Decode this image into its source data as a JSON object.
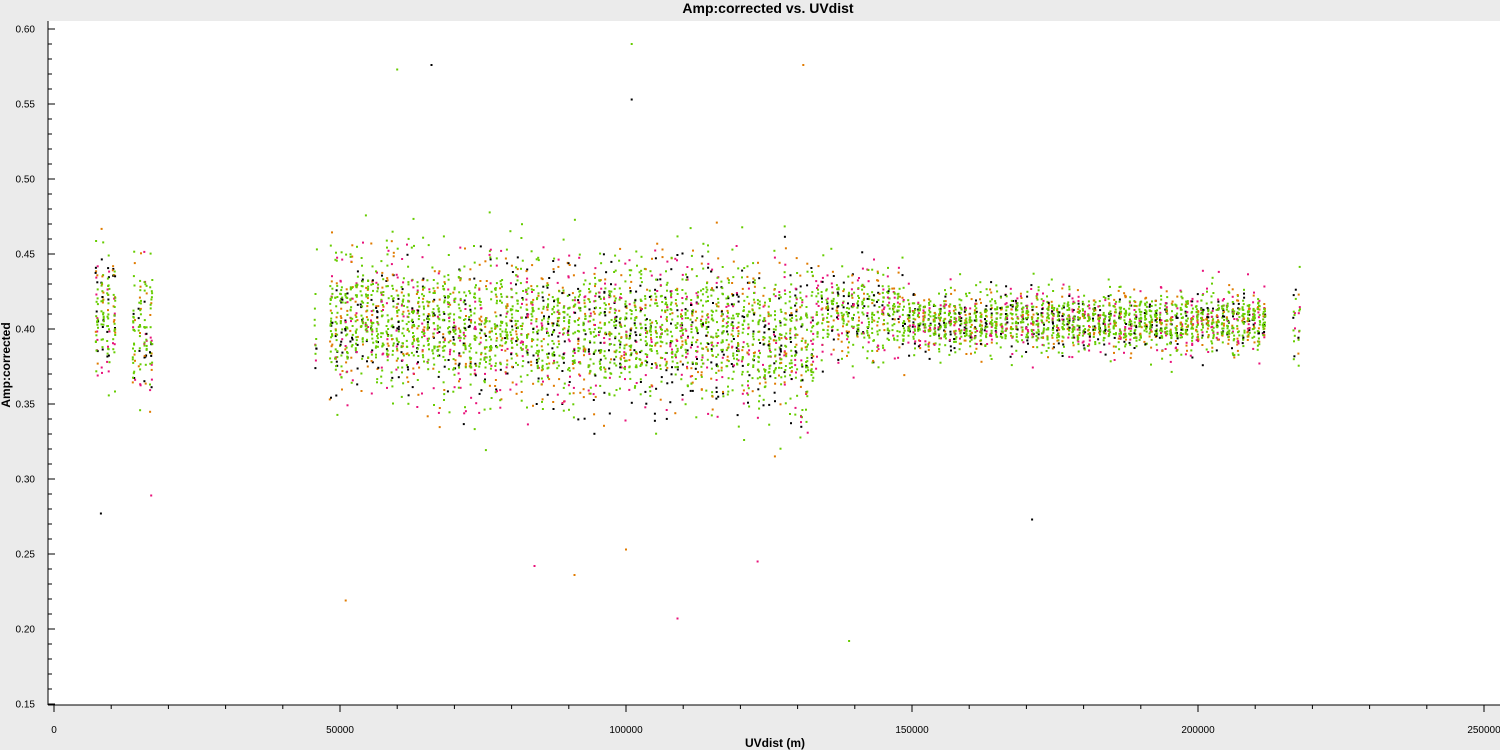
{
  "chart_data": {
    "type": "scatter",
    "title": "Amp:corrected vs. UVdist",
    "xlabel": "UVdist (m)",
    "ylabel": "Amp:corrected",
    "xlim": [
      0,
      250000
    ],
    "ylim": [
      0.15,
      0.6
    ],
    "x_ticks": [
      0,
      50000,
      100000,
      150000,
      200000,
      250000
    ],
    "x_tick_labels": [
      "0",
      "50000",
      "100000",
      "150000",
      "200000",
      "250000"
    ],
    "y_ticks": [
      0.15,
      0.2,
      0.25,
      0.3,
      0.35,
      0.4,
      0.45,
      0.5,
      0.55,
      0.6
    ],
    "y_tick_labels": [
      "0.15",
      "0.20",
      "0.25",
      "0.30",
      "0.35",
      "0.40",
      "0.45",
      "0.50",
      "0.55",
      "0.60"
    ],
    "grid": false,
    "legend": "none",
    "series_colors": [
      "#000000",
      "#e8127a",
      "#e07b00",
      "#66cc00"
    ],
    "clusters": [
      {
        "x_range": [
          7000,
          11000
        ],
        "median": 0.41,
        "spread": 0.055,
        "density": 1.0
      },
      {
        "x_range": [
          13500,
          17500
        ],
        "median": 0.4,
        "spread": 0.055,
        "density": 0.9
      },
      {
        "x_range": [
          45500,
          46000
        ],
        "median": 0.4,
        "spread": 0.06,
        "density": 0.4
      },
      {
        "x_range": [
          48000,
          65000
        ],
        "median": 0.405,
        "spread": 0.055,
        "density": 1.0
      },
      {
        "x_range": [
          65000,
          95000
        ],
        "median": 0.4,
        "spread": 0.06,
        "density": 1.0
      },
      {
        "x_range": [
          95000,
          120000
        ],
        "median": 0.4,
        "spread": 0.06,
        "density": 1.0
      },
      {
        "x_range": [
          120000,
          133000
        ],
        "median": 0.395,
        "spread": 0.065,
        "density": 1.0
      },
      {
        "x_range": [
          133000,
          149000
        ],
        "median": 0.41,
        "spread": 0.04,
        "density": 0.7
      },
      {
        "x_range": [
          149000,
          212000
        ],
        "median": 0.405,
        "spread": 0.025,
        "density": 0.9
      },
      {
        "x_range": [
          216500,
          218000
        ],
        "median": 0.405,
        "spread": 0.03,
        "density": 0.4
      }
    ],
    "outliers": [
      {
        "x": 8200,
        "y": 0.277
      },
      {
        "x": 17000,
        "y": 0.289
      },
      {
        "x": 51000,
        "y": 0.219
      },
      {
        "x": 60000,
        "y": 0.573
      },
      {
        "x": 66000,
        "y": 0.576
      },
      {
        "x": 84000,
        "y": 0.242
      },
      {
        "x": 91000,
        "y": 0.236
      },
      {
        "x": 101000,
        "y": 0.59
      },
      {
        "x": 101000,
        "y": 0.553
      },
      {
        "x": 109000,
        "y": 0.207
      },
      {
        "x": 131000,
        "y": 0.576
      },
      {
        "x": 139000,
        "y": 0.192
      },
      {
        "x": 171000,
        "y": 0.273
      },
      {
        "x": 123000,
        "y": 0.245
      },
      {
        "x": 100000,
        "y": 0.253
      }
    ]
  }
}
